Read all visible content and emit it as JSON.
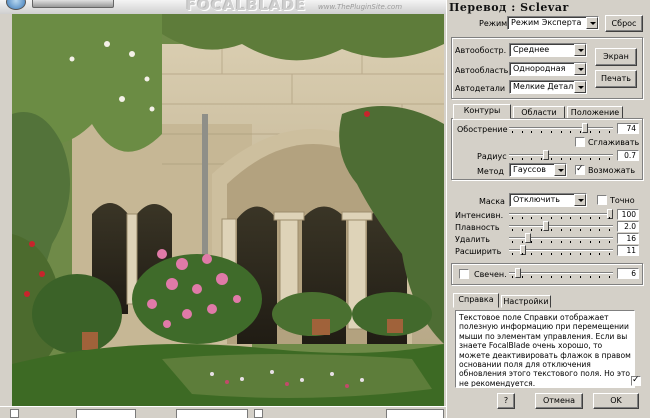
{
  "top": {
    "logo": "FOCALBLADE",
    "site": "www.ThePluginSite.com"
  },
  "panel": {
    "title": "Перевод : Sclevar",
    "mode_label": "Режим",
    "mode_value": "Режим Эксперта",
    "reset_button": "Сброс",
    "screen_button": "Экран",
    "print_button": "Печать",
    "auto_sharpen_label": "Автообостр.",
    "auto_sharpen_value": "Среднее",
    "auto_area_label": "Автообласть",
    "auto_area_value": "Однородная",
    "auto_detail_label": "Автодетали",
    "auto_detail_value": "Мелкие Детали",
    "tabs": [
      "Контуры",
      "Области",
      "Положение"
    ],
    "sharpen_label": "Обострение",
    "sharpen_value": "74",
    "smooth_label": "Сглаживать",
    "radius_label": "Радиус",
    "radius_value": "0.7",
    "method_label": "Метод",
    "method_value": "Гауссов",
    "possible_label": "Возможать",
    "mask_label": "Маска",
    "mask_value": "Отключить",
    "exact_label": "Точно",
    "intensity_label": "Интенсивн.",
    "intensity_value": "100",
    "smoothness_label": "Плавность",
    "smoothness_value": "2.0",
    "remove_label": "Удалить",
    "remove_value": "16",
    "expand_label": "Расширить",
    "expand_value": "11",
    "glow_label": "Свечен.",
    "glow_value": "6",
    "help_tabs": [
      "Справка",
      "Настройки"
    ],
    "help_text": "Текстовое поле Справки отображает полезную информацию при перемещении мыши по элементам управления. Если вы знаете FocalBlade очень хорошо, то можете деактивировать флажок в правом основании поля для отключения обновления этого текстового поля. Но это не рекомендуется.",
    "help_button": "?",
    "cancel_button": "Отмена",
    "ok_button": "OK"
  },
  "sliders": {
    "sharpen": 0.74,
    "radius": 0.35,
    "intensity": 1.0,
    "smoothness": 0.35,
    "remove": 0.16,
    "expand": 0.11,
    "glow": 0.06
  },
  "colors": {
    "face": "#d4d0c8",
    "field": "#ffffff"
  }
}
